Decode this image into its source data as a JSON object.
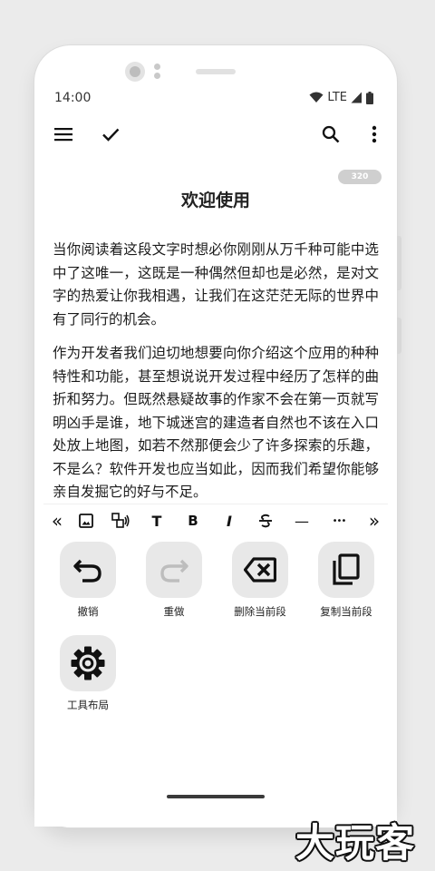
{
  "status_bar": {
    "time": "14:00",
    "network": "LTE"
  },
  "toolbar": {
    "menu_icon": "hamburger-menu-icon",
    "confirm_icon": "checkmark-icon",
    "search_icon": "search-icon",
    "more_icon": "more-vertical-icon"
  },
  "document": {
    "char_count": "320",
    "title": "欢迎使用",
    "paragraphs": [
      "当你阅读着这段文字时想必你刚刚从万千种可能中选中了这唯一，这既是一种偶然但却也是必然，是对文字的热爱让你我相遇，让我们在这茫茫无际的世界中有了同行的机会。",
      "作为开发者我们迫切地想要向你介绍这个应用的种种特性和功能，甚至想说说开发过程中经历了怎样的曲折和努力。但既然悬疑故事的作家不会在第一页就写明凶手是谁，地下城迷宫的建造者自然也不该在入口处放上地图，如若不然那便会少了许多探索的乐趣，不是么？软件开发也应当如此，因而我们希望你能够亲自发掘它的好与不足。"
    ]
  },
  "format_bar": {
    "items": [
      {
        "icon": "scroll-left-icon",
        "glyph": "«"
      },
      {
        "icon": "image-icon",
        "glyph": ""
      },
      {
        "icon": "read-aloud-icon",
        "glyph": ""
      },
      {
        "icon": "text-size-icon",
        "glyph": "T"
      },
      {
        "icon": "bold-icon",
        "glyph": "B"
      },
      {
        "icon": "italic-icon",
        "glyph": "I"
      },
      {
        "icon": "strikethrough-icon",
        "glyph": ""
      },
      {
        "icon": "horizontal-rule-icon",
        "glyph": "—"
      },
      {
        "icon": "more-horizontal-icon",
        "glyph": "•••"
      },
      {
        "icon": "scroll-right-icon",
        "glyph": "»"
      }
    ]
  },
  "actions": [
    {
      "label": "撤销",
      "icon": "undo-icon"
    },
    {
      "label": "重做",
      "icon": "redo-icon"
    },
    {
      "label": "删除当前段",
      "icon": "backspace-icon"
    },
    {
      "label": "复制当前段",
      "icon": "copy-icon"
    },
    {
      "label": "工具布局",
      "icon": "gear-icon"
    }
  ],
  "colors": {
    "tile_bg": "#e8e8e8",
    "disabled_icon": "#bdbdbd",
    "badge_bg": "#cfcfcf"
  },
  "watermark": {
    "text": "大玩客"
  }
}
